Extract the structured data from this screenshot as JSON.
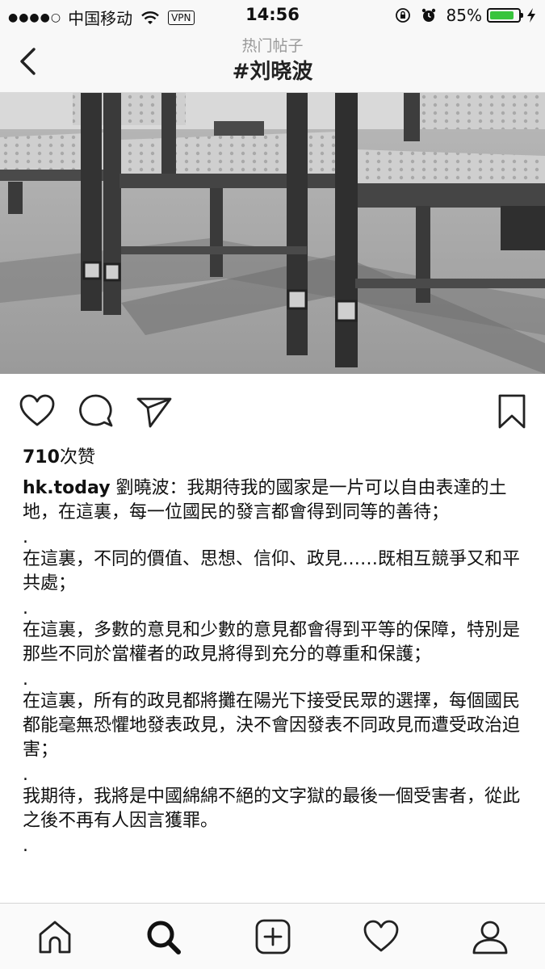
{
  "status_bar": {
    "signal": "●●●●○",
    "carrier": "中国移动",
    "vpn": "VPN",
    "time": "14:56",
    "battery_percent": "85%",
    "battery_level": 0.85,
    "battery_color": "#38c43c"
  },
  "nav": {
    "subtitle": "热门帖子",
    "title": "#刘晓波"
  },
  "post": {
    "likes_count": "710",
    "likes_suffix": "次赞",
    "username": "hk.today",
    "caption": [
      " 劉曉波：我期待我的國家是一片可以自由表達的土地，在這裏，每一位國民的發言都會得到同等的善待；",
      ".",
      "在這裏，不同的價值、思想、信仰、政見……既相互競爭又和平共處；",
      ".",
      "在這裏，多數的意見和少數的意見都會得到平等的保障，特別是那些不同於當權者的政見將得到充分的尊重和保護；",
      ".",
      "在這裏，所有的政見都將攤在陽光下接受民眾的選擇，每個國民都能毫無恐懼地發表政見，決不會因發表不同政見而遭受政治迫害；",
      ".",
      "我期待，我將是中國綿綿不絕的文字獄的最後一個受害者，從此之後不再有人因言獲罪。",
      "."
    ]
  },
  "icons": {
    "back": "chevron-left-icon",
    "like": "heart-icon",
    "comment": "comment-icon",
    "share": "send-icon",
    "save": "bookmark-icon",
    "tabs": [
      "home-icon",
      "search-icon",
      "add-icon",
      "activity-icon",
      "profile-icon"
    ]
  }
}
